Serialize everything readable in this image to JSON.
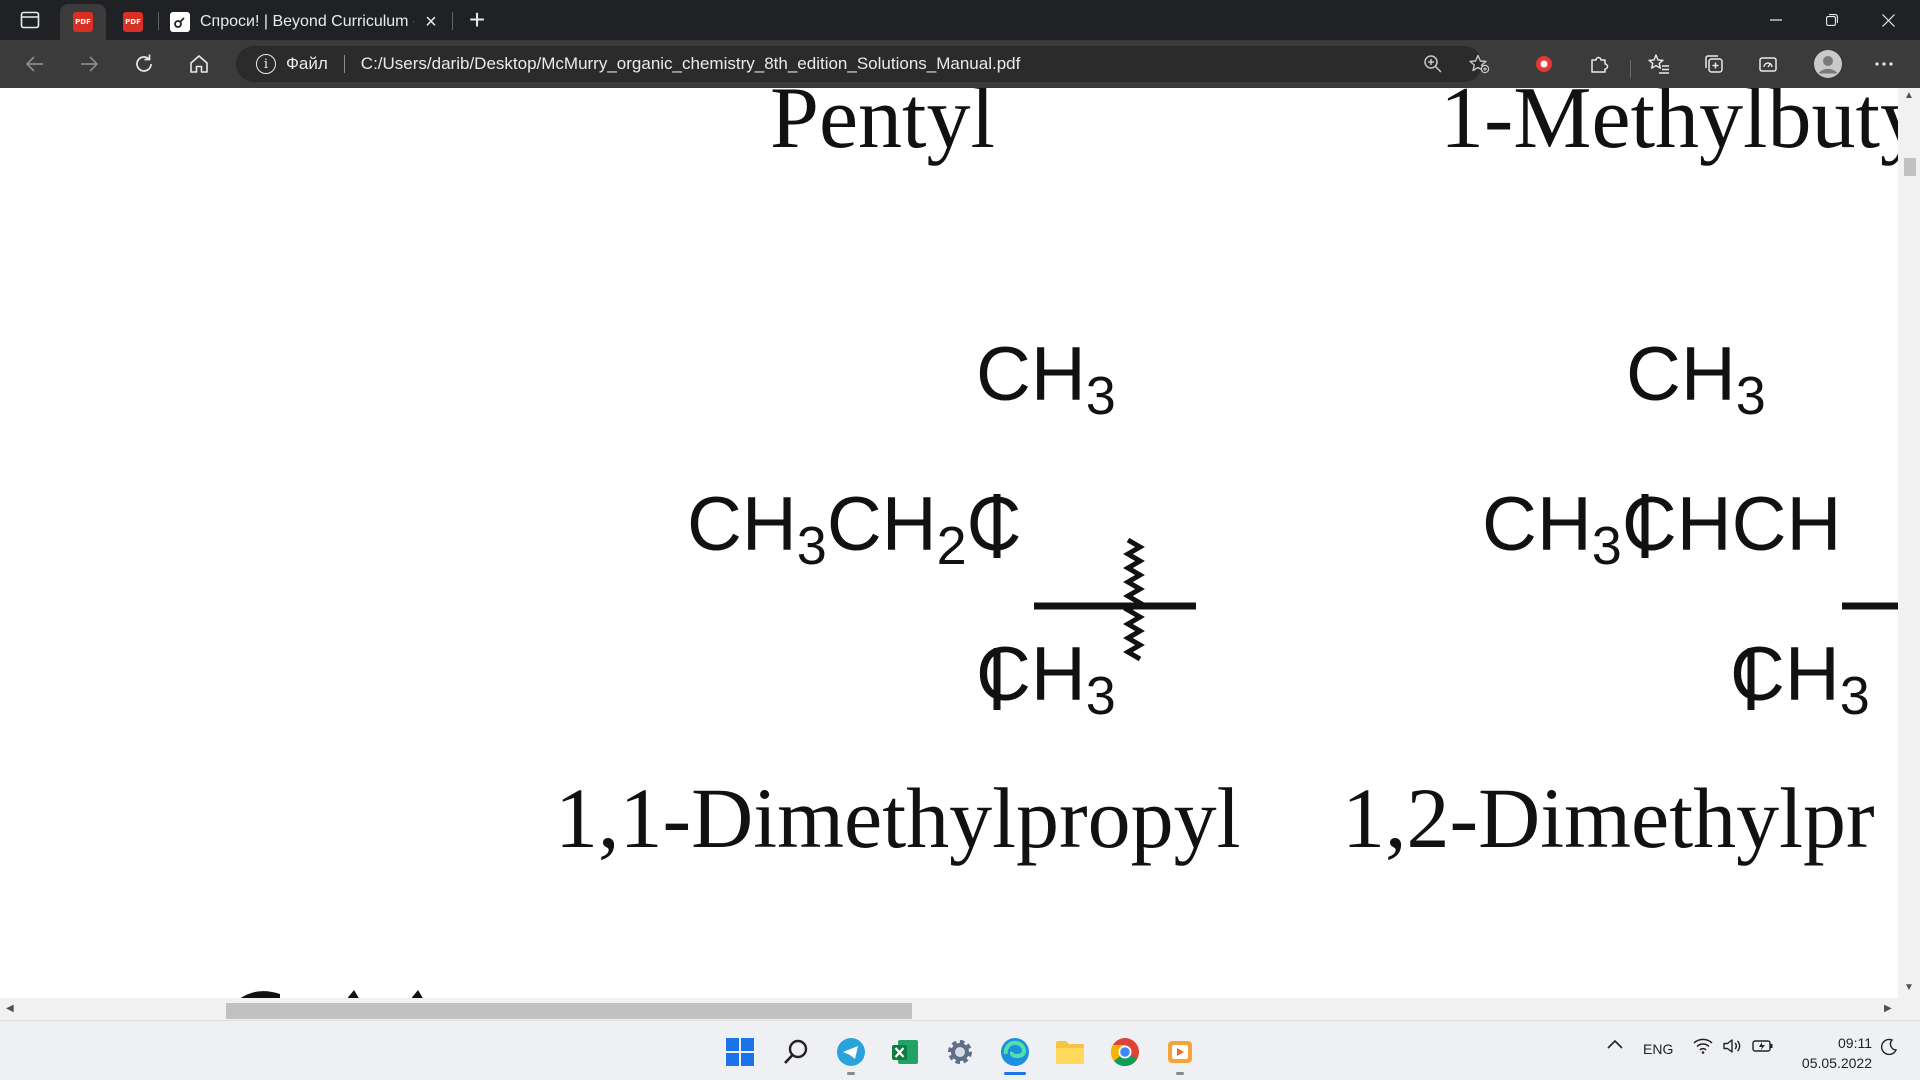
{
  "browser": {
    "tabs": [
      {
        "icon": "pdf-icon",
        "label": "PDF"
      },
      {
        "icon": "pdf-icon",
        "label": "PDF"
      },
      {
        "icon": "site-favicon",
        "title": "Спроси! | Beyond Curriculum - P"
      }
    ],
    "address": {
      "scheme_label": "Файл",
      "url": "C:/Users/darib/Desktop/McMurry_organic_chemistry_8th_edition_Solutions_Manual.pdf"
    }
  },
  "document": {
    "top_labels": [
      "Pentyl",
      "1-Methylbuty"
    ],
    "structure_left": {
      "top_group": "CH",
      "top_sub": "3",
      "main_1": "CH",
      "main_sub_1": "3",
      "main_2": "CH",
      "main_sub_2": "2",
      "main_3": "C",
      "bottom_group": "CH",
      "bottom_sub": "3",
      "name": "1,1-Dimethylpropyl"
    },
    "structure_right": {
      "top_group": "CH",
      "top_sub": "3",
      "main_1": "CH",
      "main_sub_1": "3",
      "main_2": "CHCH",
      "bottom_group": "CH",
      "bottom_sub": "3",
      "name": "1,2-Dimethylpr"
    }
  },
  "taskbar": {
    "language": "ENG",
    "time": "09:11",
    "date": "05.05.2022"
  },
  "colors": {
    "tabbar_bg": "#202124",
    "toolbar_bg": "#3b3b3b",
    "pdf_red": "#d93025",
    "taskbar_bg": "#eef0f3"
  }
}
